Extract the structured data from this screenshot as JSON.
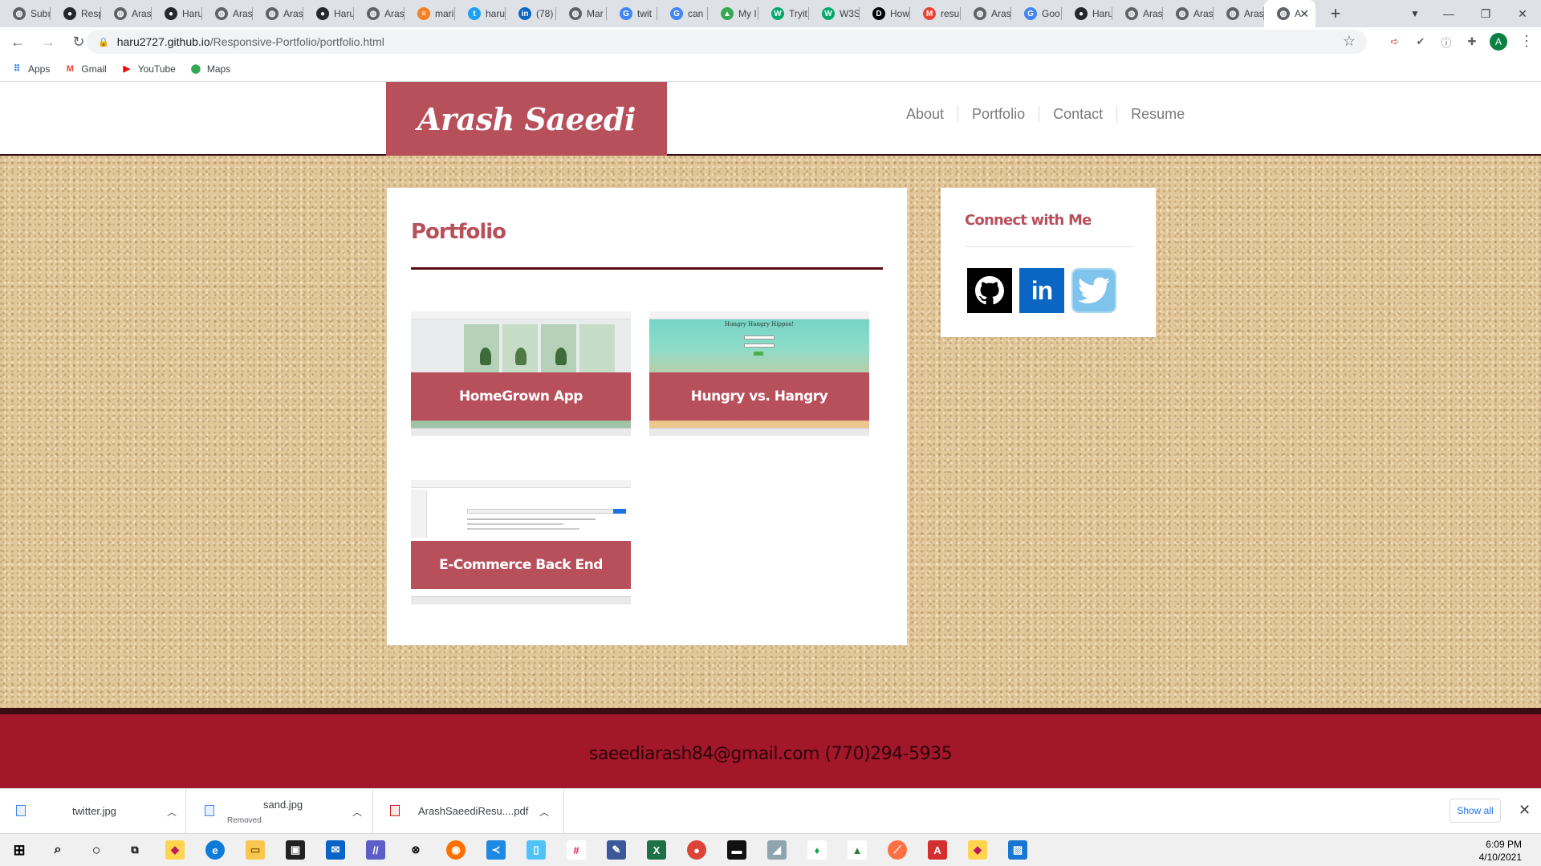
{
  "browser": {
    "tabs": [
      {
        "label": "Subı",
        "icon": "generic-globe-icon"
      },
      {
        "label": "Resp",
        "icon": "github-icon"
      },
      {
        "label": "Aras",
        "icon": "generic-globe-icon"
      },
      {
        "label": "Haru",
        "icon": "github-icon"
      },
      {
        "label": "Aras",
        "icon": "generic-globe-icon"
      },
      {
        "label": "Aras",
        "icon": "generic-globe-icon"
      },
      {
        "label": "Haru",
        "icon": "github-icon"
      },
      {
        "label": "Aras",
        "icon": "generic-globe-icon"
      },
      {
        "label": "mari",
        "icon": "stack-icon"
      },
      {
        "label": "haru",
        "icon": "twitter-icon"
      },
      {
        "label": "(78)",
        "icon": "linkedin-icon"
      },
      {
        "label": "Mar",
        "icon": "generic-globe-icon"
      },
      {
        "label": "twit",
        "icon": "google-icon"
      },
      {
        "label": "can",
        "icon": "google-icon"
      },
      {
        "label": "My I",
        "icon": "drive-icon"
      },
      {
        "label": "Tryit",
        "icon": "w3schools-icon"
      },
      {
        "label": "W3S",
        "icon": "w3schools-icon"
      },
      {
        "label": "How",
        "icon": "dev-icon"
      },
      {
        "label": "resu",
        "icon": "gmail-icon"
      },
      {
        "label": "Aras",
        "icon": "generic-globe-icon"
      },
      {
        "label": "Goo",
        "icon": "google-icon"
      },
      {
        "label": "Haru",
        "icon": "github-icon"
      },
      {
        "label": "Aras",
        "icon": "generic-globe-icon"
      },
      {
        "label": "Aras",
        "icon": "generic-globe-icon"
      },
      {
        "label": "Aras",
        "icon": "generic-globe-icon"
      },
      {
        "label": "A",
        "icon": "generic-globe-icon",
        "active": true
      }
    ],
    "url_host": "haru2727.github.io",
    "url_path": "/Responsive-Portfolio/portfolio.html",
    "bookmarks": [
      {
        "label": "Apps",
        "icon": "apps-grid-icon"
      },
      {
        "label": "Gmail",
        "icon": "gmail-icon"
      },
      {
        "label": "YouTube",
        "icon": "youtube-icon"
      },
      {
        "label": "Maps",
        "icon": "maps-pin-icon"
      }
    ],
    "profile_initial": "A"
  },
  "site": {
    "logo": "Arash Saeedi",
    "nav": [
      "About",
      "Portfolio",
      "Contact",
      "Resume"
    ],
    "portfolio_heading": "Portfolio",
    "projects": [
      {
        "title": "HomeGrown App"
      },
      {
        "title": "Hungry vs. Hangry",
        "screenshot_heading": "Hungry Hungry Hippos!"
      },
      {
        "title": "E-Commerce Back End"
      }
    ],
    "connect_heading": "Connect with Me",
    "social": [
      "github-icon",
      "linkedin-icon",
      "twitter-icon"
    ],
    "footer": "saeediarash84@gmail.com (770)294-5935",
    "colors": {
      "accent": "#b8505c",
      "footer": "#a3172a",
      "dark": "#3a0d10",
      "sand": "#e2c79a"
    }
  },
  "downloads": {
    "items": [
      {
        "name": "twitter.jpg",
        "status": ""
      },
      {
        "name": "sand.jpg",
        "status": "Removed"
      },
      {
        "name": "ArashSaeediResu....pdf",
        "status": ""
      }
    ],
    "show_all": "Show all"
  },
  "taskbar": {
    "time": "6:09 PM",
    "date": "4/10/2021"
  }
}
